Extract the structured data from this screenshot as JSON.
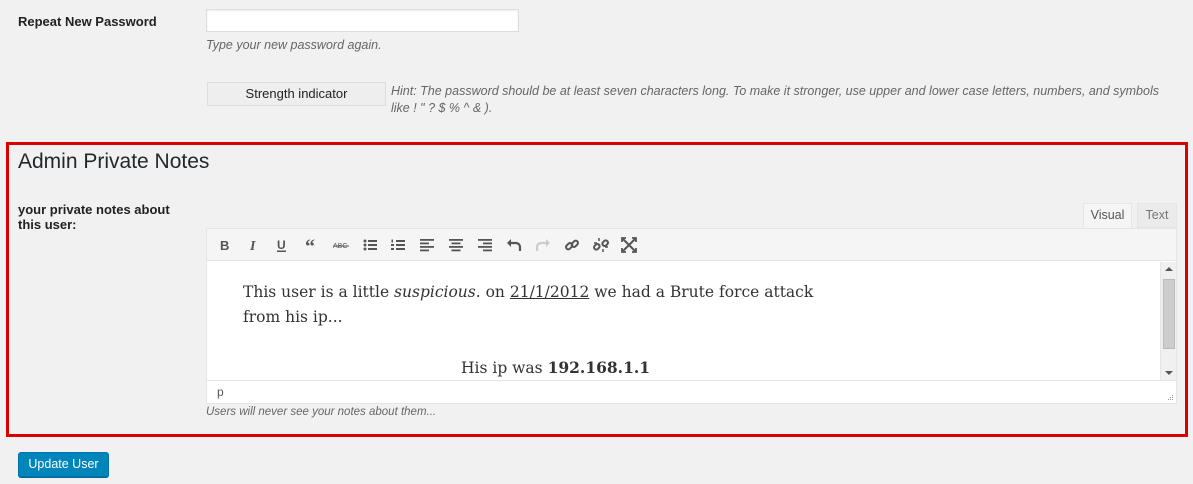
{
  "password": {
    "repeat_label": "Repeat New Password",
    "repeat_value": "",
    "repeat_desc": "Type your new password again.",
    "strength_label": "Strength indicator",
    "hint": "Hint: The password should be at least seven characters long. To make it stronger, use upper and lower case letters, numbers, and symbols like ! \" ? $ % ^ & )."
  },
  "notes": {
    "section_title": "Admin Private Notes",
    "field_label": "your private notes about this user:",
    "tabs": [
      {
        "label": "Visual",
        "active": true
      },
      {
        "label": "Text",
        "active": false
      }
    ],
    "toolbar_icons": [
      "bold-icon",
      "italic-icon",
      "underline-icon",
      "blockquote-icon",
      "strikethrough-icon",
      "bulleted-list-icon",
      "numbered-list-icon",
      "align-left-icon",
      "align-center-icon",
      "align-right-icon",
      "undo-icon",
      "redo-icon",
      "link-icon",
      "unlink-icon",
      "fullscreen-icon"
    ],
    "toolbar_abc": "ABC",
    "content": {
      "p1_start": "This user is a little ",
      "p1_em": "suspicious",
      "p1_mid": ". on ",
      "p1_date": "21/1/2012",
      "p1_end": " we had a Brute force attack from his ip...",
      "p2_start": "His ip was ",
      "p2_ip": "192.168.1.1"
    },
    "path": "p",
    "description": "Users will never see your notes about them..."
  },
  "actions": {
    "update_label": "Update User"
  },
  "colors": {
    "highlight_border": "#dd0000",
    "primary_button": "#0085ba"
  }
}
